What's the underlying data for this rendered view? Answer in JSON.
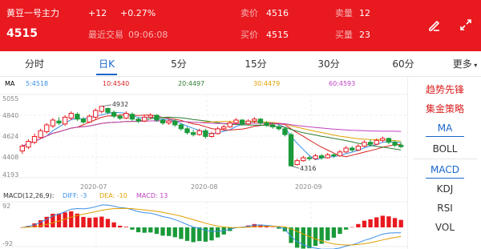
{
  "header": {
    "name": "黄豆一号主力",
    "change": "+12",
    "change_pct": "+0.27%",
    "price": "4515",
    "time_label": "最近交易",
    "time": "09:06:08",
    "sell_price_label": "卖价",
    "sell_price": "4516",
    "buy_price_label": "买价",
    "buy_price": "4515",
    "sell_vol_label": "卖量",
    "sell_vol": "12",
    "buy_vol_label": "买量",
    "buy_vol": "23"
  },
  "icons": {
    "draw": "pen-draw-icon",
    "fullscreen": "expand-arrows-icon"
  },
  "tabs": [
    "分时",
    "日K",
    "5分",
    "15分",
    "30分",
    "60分",
    "更多"
  ],
  "active_tab": "日K",
  "ma_legend": [
    {
      "label": "MA",
      "color": "#333333"
    },
    {
      "label": "5:4518",
      "color": "#3a8ee6"
    },
    {
      "label": "10:4540",
      "color": "#d9201f"
    },
    {
      "label": "20:4497",
      "color": "#2e7d32"
    },
    {
      "label": "30:4479",
      "color": "#e0a000"
    },
    {
      "label": "60:4593",
      "color": "#c040c0"
    }
  ],
  "macd_legend": [
    {
      "label": "MACD(12,26,9):",
      "color": "#333333"
    },
    {
      "label": "DIFF: -3",
      "color": "#3a8ee6"
    },
    {
      "label": "DEA: -10",
      "color": "#e0a000"
    },
    {
      "label": "MACD: 13",
      "color": "#c040c0"
    }
  ],
  "side_menu": {
    "strategy1": "趋势先锋",
    "strategy2": "集金策略",
    "ma": "MA",
    "boll": "BOLL",
    "macd": "MACD",
    "kdj": "KDJ",
    "rsi": "RSI",
    "vol": "VOL"
  },
  "chart_data": [
    {
      "type": "candlestick",
      "y_ticks": [
        "5055",
        "4840",
        "4624",
        "4408",
        "4193"
      ],
      "x_ticks": [
        "2020-07",
        "2020-08",
        "2020-09"
      ],
      "annotations": {
        "high": "4932",
        "low": "4316"
      },
      "ylim": [
        4193,
        5055
      ],
      "candles": [
        [
          4470,
          4520,
          4440,
          4540
        ],
        [
          4510,
          4570,
          4490,
          4590
        ],
        [
          4560,
          4620,
          4540,
          4650
        ],
        [
          4610,
          4680,
          4600,
          4700
        ],
        [
          4670,
          4740,
          4650,
          4760
        ],
        [
          4730,
          4790,
          4710,
          4810
        ],
        [
          4780,
          4760,
          4740,
          4820
        ],
        [
          4750,
          4820,
          4730,
          4840
        ],
        [
          4810,
          4860,
          4790,
          4880
        ],
        [
          4850,
          4800,
          4780,
          4870
        ],
        [
          4800,
          4770,
          4750,
          4820
        ],
        [
          4770,
          4830,
          4760,
          4850
        ],
        [
          4820,
          4890,
          4800,
          4910
        ],
        [
          4880,
          4932,
          4860,
          4932
        ],
        [
          4910,
          4870,
          4850,
          4920
        ],
        [
          4870,
          4830,
          4810,
          4890
        ],
        [
          4830,
          4810,
          4790,
          4850
        ],
        [
          4810,
          4860,
          4800,
          4880
        ],
        [
          4850,
          4800,
          4780,
          4870
        ],
        [
          4800,
          4780,
          4760,
          4820
        ],
        [
          4780,
          4820,
          4770,
          4840
        ],
        [
          4820,
          4840,
          4800,
          4860
        ],
        [
          4840,
          4790,
          4770,
          4850
        ],
        [
          4790,
          4760,
          4740,
          4810
        ],
        [
          4760,
          4780,
          4740,
          4800
        ],
        [
          4780,
          4740,
          4720,
          4800
        ],
        [
          4740,
          4700,
          4680,
          4760
        ],
        [
          4700,
          4660,
          4640,
          4720
        ],
        [
          4660,
          4640,
          4620,
          4690
        ],
        [
          4640,
          4680,
          4630,
          4700
        ],
        [
          4680,
          4620,
          4600,
          4700
        ],
        [
          4620,
          4650,
          4610,
          4670
        ],
        [
          4650,
          4700,
          4640,
          4720
        ],
        [
          4700,
          4720,
          4680,
          4740
        ],
        [
          4720,
          4760,
          4710,
          4780
        ],
        [
          4760,
          4790,
          4740,
          4810
        ],
        [
          4790,
          4750,
          4730,
          4800
        ],
        [
          4750,
          4780,
          4740,
          4800
        ],
        [
          4780,
          4800,
          4760,
          4820
        ],
        [
          4800,
          4760,
          4740,
          4810
        ],
        [
          4760,
          4740,
          4720,
          4780
        ],
        [
          4740,
          4720,
          4700,
          4760
        ],
        [
          4720,
          4700,
          4680,
          4740
        ],
        [
          4700,
          4640,
          4620,
          4710
        ],
        [
          4640,
          4316,
          4316,
          4660
        ],
        [
          4330,
          4370,
          4320,
          4390
        ],
        [
          4370,
          4400,
          4360,
          4420
        ],
        [
          4400,
          4390,
          4370,
          4420
        ],
        [
          4390,
          4420,
          4380,
          4440
        ],
        [
          4420,
          4400,
          4380,
          4440
        ],
        [
          4400,
          4430,
          4390,
          4450
        ],
        [
          4430,
          4420,
          4400,
          4450
        ],
        [
          4420,
          4460,
          4410,
          4480
        ],
        [
          4460,
          4500,
          4450,
          4520
        ],
        [
          4500,
          4480,
          4460,
          4520
        ],
        [
          4480,
          4520,
          4470,
          4540
        ],
        [
          4520,
          4560,
          4510,
          4580
        ],
        [
          4560,
          4540,
          4520,
          4590
        ],
        [
          4540,
          4580,
          4530,
          4600
        ],
        [
          4580,
          4600,
          4560,
          4620
        ],
        [
          4600,
          4560,
          4540,
          4610
        ],
        [
          4560,
          4530,
          4510,
          4580
        ],
        [
          4530,
          4515,
          4500,
          4560
        ]
      ],
      "macd_ylim": [
        -92,
        92
      ],
      "macd_ticks": [
        "92",
        "-92"
      ]
    }
  ]
}
